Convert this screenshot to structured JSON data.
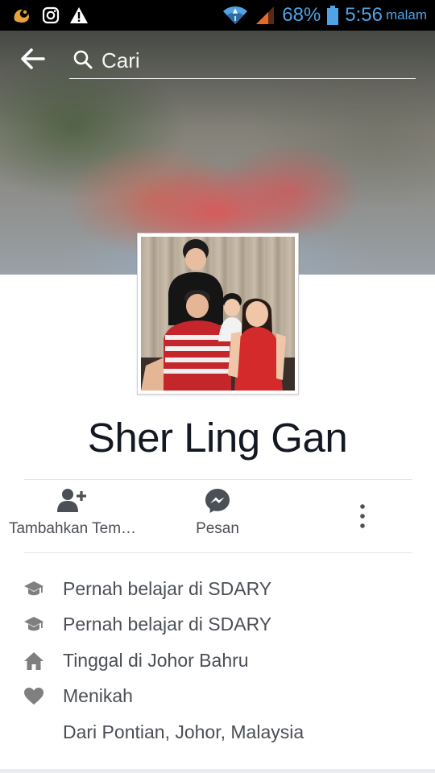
{
  "status_bar": {
    "battery_percent": "68%",
    "time": "5:56",
    "time_suffix": "malam",
    "icons": [
      "uc-browser-icon",
      "instagram-icon",
      "warning-icon",
      "wifi-icon",
      "signal-icon",
      "battery-icon"
    ]
  },
  "header": {
    "back_icon": "arrow-left-icon",
    "search_placeholder": "Cari"
  },
  "profile": {
    "name": "Sher Ling Gan"
  },
  "actions": [
    {
      "label": "Tambahkan Tem…",
      "icon": "add-friend-icon"
    },
    {
      "label": "Pesan",
      "icon": "messenger-icon"
    },
    {
      "label": "",
      "icon": "more-vertical-icon"
    }
  ],
  "intro": [
    {
      "icon": "education-icon",
      "text": "Pernah belajar di SDARY"
    },
    {
      "icon": "education-icon",
      "text": "Pernah belajar di SDARY"
    },
    {
      "icon": "home-icon",
      "text": "Tinggal di Johor Bahru"
    },
    {
      "icon": "heart-icon",
      "text": "Menikah"
    },
    {
      "icon": "",
      "text": "Dari Pontian, Johor, Malaysia"
    }
  ],
  "colors": {
    "status_blue": "#4fa3e6",
    "text_dark": "#141823",
    "text_gray": "#4b4f56",
    "icon_gray": "#7f7f7f",
    "divider": "#e5e6e9"
  }
}
